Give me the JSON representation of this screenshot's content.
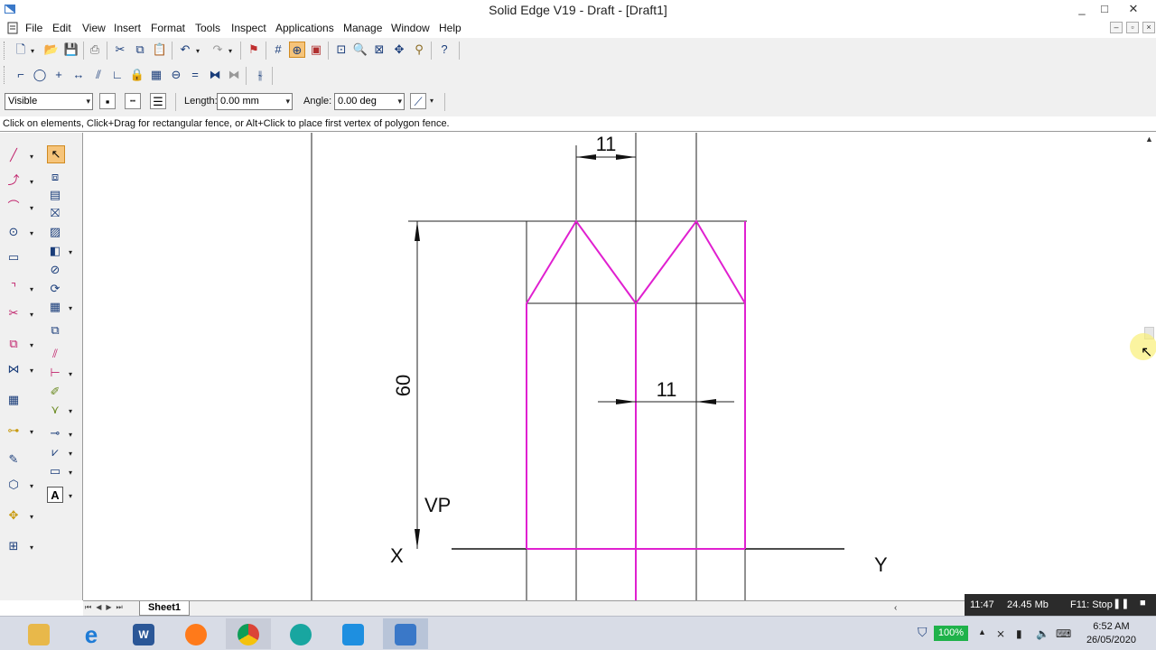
{
  "window": {
    "title": "Solid Edge V19 - Draft - [Draft1]",
    "controls": [
      "_",
      "□",
      "✕"
    ]
  },
  "menu": [
    "File",
    "Edit",
    "View",
    "Insert",
    "Format",
    "Tools",
    "Inspect",
    "Applications",
    "Manage",
    "Window",
    "Help"
  ],
  "ribbon": {
    "linetype_value": "Visible",
    "length_label": "Length:",
    "length_value": "0.00 mm",
    "angle_label": "Angle:",
    "angle_value": "0.00 deg"
  },
  "prompt": "Click on elements, Click+Drag for rectangular fence, or Alt+Click to place first vertex of polygon fence.",
  "drawing": {
    "dim_top": "11",
    "dim_middle": "11",
    "dim_height": "60",
    "label_vp": "VP",
    "label_x": "X",
    "label_y": "Y",
    "line_color": "#222222",
    "profile_color": "#e020d0"
  },
  "sheet_tab": "Sheet1",
  "recorder": {
    "time": "11:47",
    "size": "24.45 Mb",
    "hint": "F11: Stop"
  },
  "taskbar": {
    "apps": [
      "file-explorer",
      "internet-explorer",
      "word",
      "firefox",
      "chrome",
      "screen-recorder",
      "capture-tool",
      "solid-edge"
    ],
    "battery": "100%",
    "time": "6:52 AM",
    "date": "26/05/2020"
  }
}
